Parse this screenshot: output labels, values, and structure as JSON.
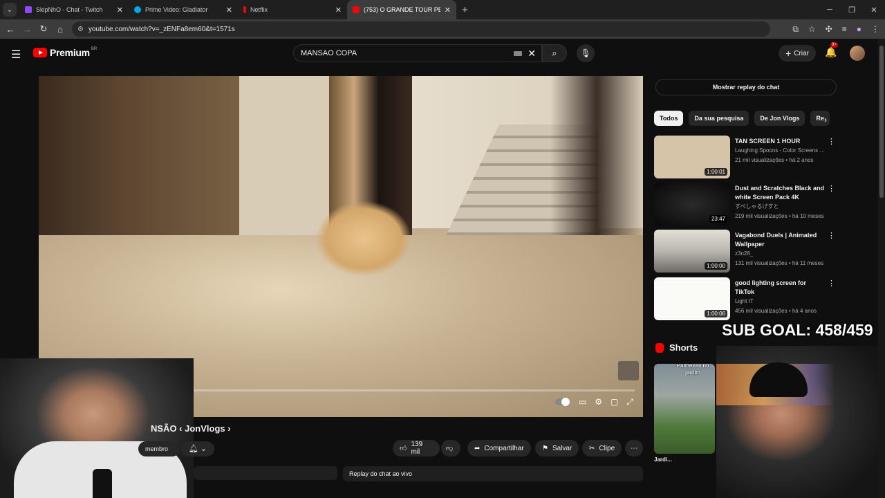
{
  "browser": {
    "tabs": [
      {
        "title": "SkipNhO - Chat - Twitch",
        "color": "#9146ff"
      },
      {
        "title": "Prime Video: Gladiator",
        "color": "#00a8e1"
      },
      {
        "title": "Netflix",
        "color": "#e50914"
      },
      {
        "title": "(753) O GRANDE TOUR PELA M",
        "color": "#ff0000"
      }
    ],
    "url": "youtube.com/watch?v=_zENFa8em60&t=1571s"
  },
  "youtube": {
    "logo": "Premium",
    "country": "BR",
    "search_value": "MANSAO COPA",
    "criar_label": "Criar",
    "notif_badge": "9+"
  },
  "video": {
    "title_partial": "NSÃO ‹ JonVlogs ›",
    "progress_fraction": 0.19,
    "membro_label": "membro",
    "likes": "139 mil",
    "share_label": "Compartilhar",
    "save_label": "Salvar",
    "clip_label": "Clipe",
    "chat_replay_label": "Replay do chat ao vivo"
  },
  "sidebar": {
    "show_chat_label": "Mostrar replay do chat",
    "chips": [
      "Todos",
      "Da sua pesquisa",
      "De Jon Vlogs",
      "Re"
    ],
    "recommendations": [
      {
        "title": "TAN SCREEN 1 HOUR",
        "channel": "Laughing Spoons - Color Screens & Scre...",
        "meta": "21 mil visualizações • há 2 anos",
        "duration": "1:00:01",
        "thumb": "#d6c4a8"
      },
      {
        "title": "Dust and Scratches Black and white Screen Pack 4K",
        "channel": "すぺしゃるげすと",
        "meta": "219 mil visualizações • há 10 meses",
        "duration": "23:47",
        "thumb": "#111111"
      },
      {
        "title": "Vagabond Duels | Animated Wallpaper",
        "channel": "z3n28_",
        "meta": "131 mil visualizações • há 11 meses",
        "duration": "1:00:00",
        "thumb": "#b8b6ae"
      },
      {
        "title": "good lighting screen for TikTok",
        "channel": "Light IT",
        "meta": "456 mil visualizações • há 4 anos",
        "duration": "1:00:06",
        "thumb": "#fafaf7"
      }
    ],
    "shorts_label": "Shorts",
    "short1_overlay": "Palmeiras no jardim",
    "short1_title": "Jardi..."
  },
  "overlay": {
    "sub_goal": "SUB GOAL: 458/459"
  }
}
